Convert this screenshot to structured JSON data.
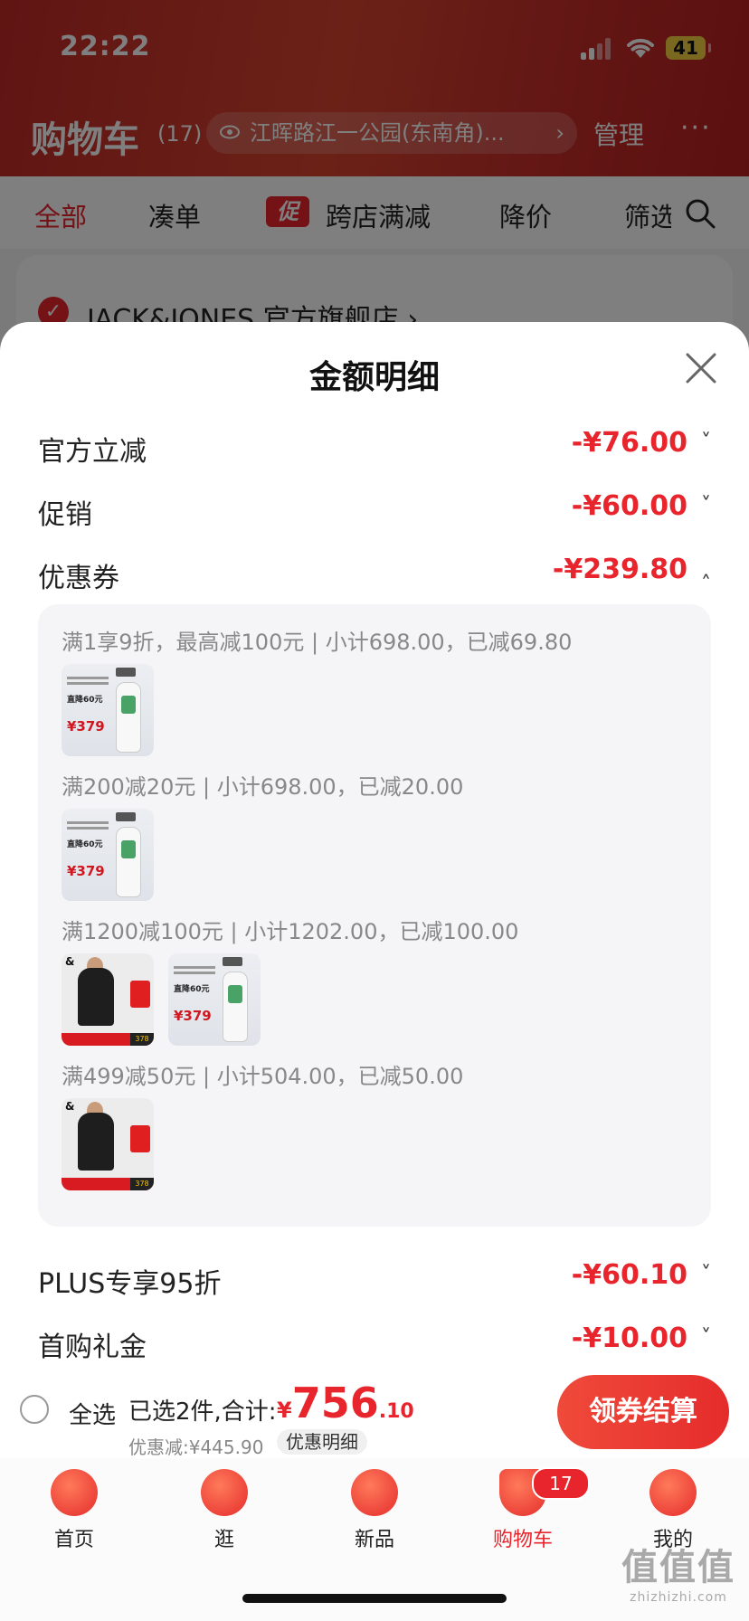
{
  "status_bar": {
    "time": "22:22",
    "battery": "41"
  },
  "header": {
    "title": "购物车",
    "count": "(17)",
    "address": "江晖路江一公园(东南角)...",
    "manage": "管理",
    "more": "···"
  },
  "filters": {
    "items": [
      "全部",
      "凑单",
      "跨店满减",
      "降价",
      "筛选"
    ],
    "promo_tag": "促"
  },
  "store": {
    "name": "JACK&JONES 官方旗舰店 ›"
  },
  "sheet": {
    "title": "金额明细",
    "rows": [
      {
        "label": "官方立减",
        "amount": "-¥76.00"
      },
      {
        "label": "促销",
        "amount": "-¥60.00"
      },
      {
        "label": "优惠券",
        "amount": "-¥239.80"
      },
      {
        "label": "PLUS专享95折",
        "amount": "-¥60.10"
      },
      {
        "label": "首购礼金",
        "amount": "-¥10.00"
      }
    ],
    "caret": "˅",
    "coupon_rules": [
      "满1享9折，最高减100元 | 小计698.00，已减69.80",
      "满200减20元 | 小计698.00，已减20.00",
      "满1200减100元 | 小计1202.00，已减100.00",
      "满499减50元 | 小计504.00，已减50.00"
    ],
    "thermometer_thumb": {
      "drop": "直降60元",
      "price": "¥379"
    },
    "jj_thumb": {
      "logo": "&",
      "code": "378"
    }
  },
  "checkout": {
    "select_all": "全选",
    "selected_summary": "已选2件,合计:",
    "currency": "¥",
    "total_int": "756",
    "total_dec": ".10",
    "discount": "优惠减:¥445.90",
    "detail_link": "优惠明细",
    "button": "领券结算"
  },
  "tabs": [
    {
      "label": "首页",
      "icon": "home-icon"
    },
    {
      "label": "逛",
      "icon": "browse-icon"
    },
    {
      "label": "新品",
      "icon": "new-items-icon"
    },
    {
      "label": "购物车",
      "icon": "cart-icon"
    },
    {
      "label": "我的",
      "icon": "profile-icon"
    }
  ],
  "cart_badge": "17",
  "watermark": {
    "big": "值值值",
    "small": "zhizhizhi.com"
  },
  "colors": {
    "accent": "#e8252c",
    "header_red": "#c9302a"
  }
}
